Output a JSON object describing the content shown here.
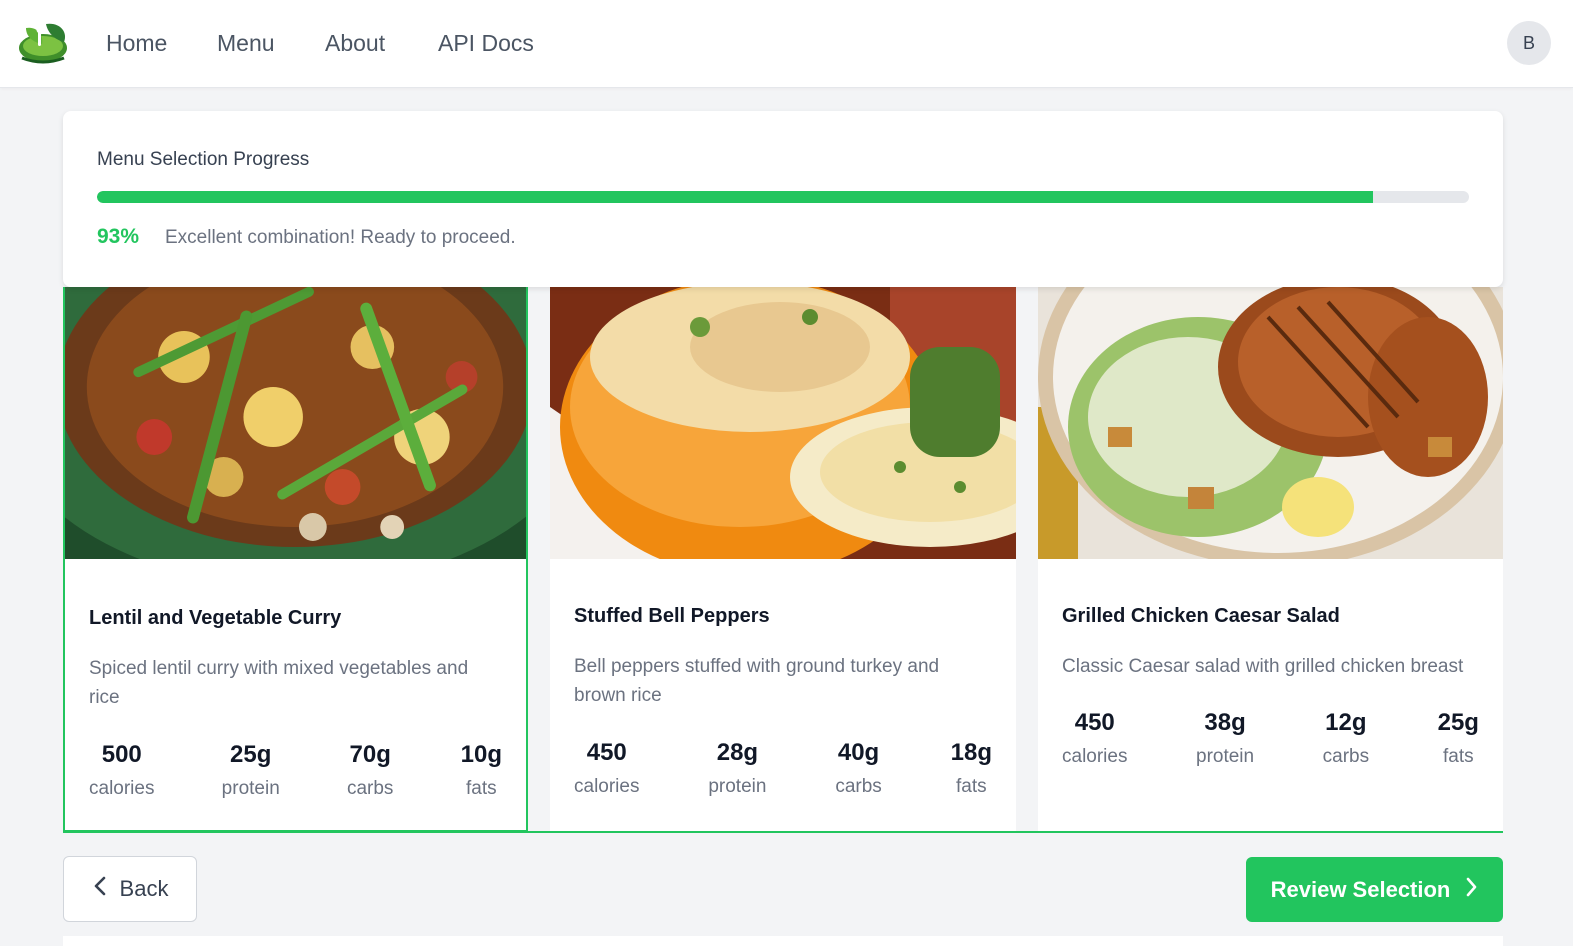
{
  "nav": {
    "links": [
      "Home",
      "Menu",
      "About",
      "API Docs"
    ],
    "avatar_initial": "B"
  },
  "progress": {
    "title": "Menu Selection Progress",
    "percent_label": "93%",
    "percent_value": 93,
    "message": "Excellent combination! Ready to proceed."
  },
  "meals": [
    {
      "title": "Lentil and Vegetable Curry",
      "description": "Spiced lentil curry with mixed vegetables and rice",
      "selected": true,
      "stats": [
        {
          "value": "500",
          "label": "calories"
        },
        {
          "value": "25g",
          "label": "protein"
        },
        {
          "value": "70g",
          "label": "carbs"
        },
        {
          "value": "10g",
          "label": "fats"
        }
      ]
    },
    {
      "title": "Stuffed Bell Peppers",
      "description": "Bell peppers stuffed with ground turkey and brown rice",
      "selected": false,
      "stats": [
        {
          "value": "450",
          "label": "calories"
        },
        {
          "value": "28g",
          "label": "protein"
        },
        {
          "value": "40g",
          "label": "carbs"
        },
        {
          "value": "18g",
          "label": "fats"
        }
      ]
    },
    {
      "title": "Grilled Chicken Caesar Salad",
      "description": "Classic Caesar salad with grilled chicken breast",
      "selected": false,
      "stats": [
        {
          "value": "450",
          "label": "calories"
        },
        {
          "value": "38g",
          "label": "protein"
        },
        {
          "value": "12g",
          "label": "carbs"
        },
        {
          "value": "25g",
          "label": "fats"
        }
      ]
    }
  ],
  "actions": {
    "back_label": "Back",
    "review_label": "Review Selection"
  },
  "colors": {
    "accent": "#22c55e",
    "text_muted": "#6b7280",
    "background": "#f3f4f6"
  },
  "icons": {
    "logo": "leaf-bowl-logo",
    "back": "chevron-left-icon",
    "review": "chevron-right-icon"
  }
}
